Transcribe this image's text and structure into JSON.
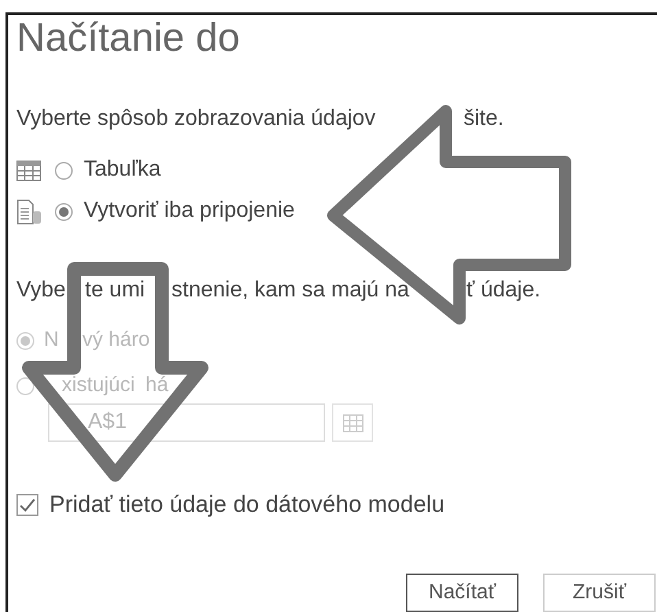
{
  "dialog": {
    "title": "Načítanie do"
  },
  "view_prompt": [
    "Vyberte spôsob zobrazovania údajov",
    "šite."
  ],
  "view_options": [
    {
      "label": "Tabuľka",
      "selected": false
    },
    {
      "label": "Vytvoriť iba pripojenie",
      "selected": true
    }
  ],
  "location_prompt": [
    "Vybe",
    "te umi",
    "stnenie, kam sa majú na",
    "ť údaje."
  ],
  "location_options": [
    {
      "label": [
        "N",
        "vý háro"
      ],
      "selected": true,
      "disabled": true
    },
    {
      "label": [
        "xistujúci",
        "há"
      ],
      "selected": false,
      "disabled": true
    }
  ],
  "location_field": {
    "value": "A$1",
    "disabled": true
  },
  "data_model": {
    "label": "Pridať tieto údaje do dátového modelu",
    "checked": true
  },
  "buttons": [
    {
      "label": "Načítať",
      "default": true
    },
    {
      "label": "Zrušiť",
      "default": false
    }
  ]
}
